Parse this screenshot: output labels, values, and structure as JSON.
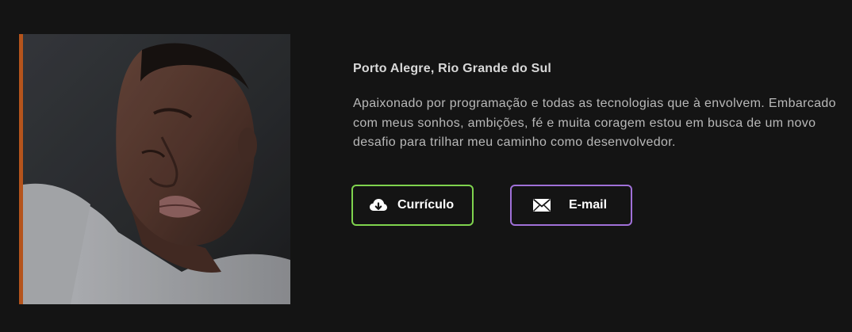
{
  "profile": {
    "photo_alt": "profile-photo",
    "location": "Porto Alegre, Rio Grande do Sul",
    "bio": "Apaixonado por programação e todas as tecnologias que à envolvem. Embarcado com meus sonhos, ambições, fé e muita coragem estou em busca de um novo desafio para trilhar meu caminho como desenvolvedor."
  },
  "buttons": {
    "cv_label": "Currículo",
    "cv_icon": "cloud-download-icon",
    "cv_border_color": "#7fd34e",
    "email_label": "E-mail",
    "email_icon": "envelope-icon",
    "email_border_color": "#a070d8"
  },
  "colors": {
    "background": "#141414",
    "accent_bar": "#b5541c"
  }
}
